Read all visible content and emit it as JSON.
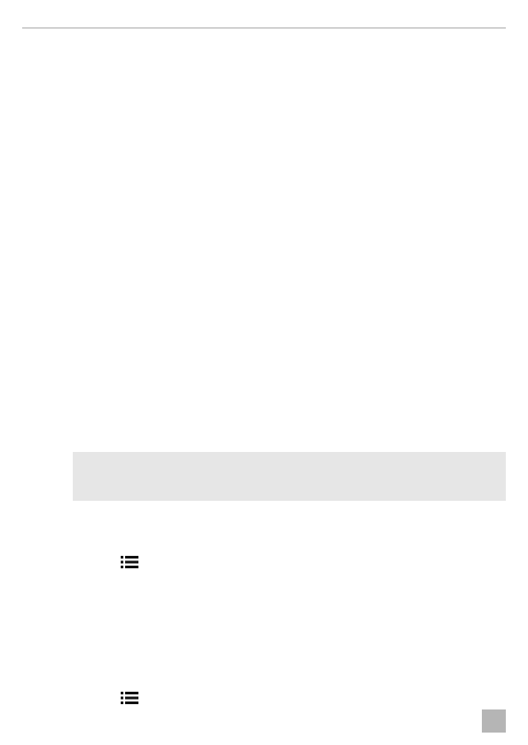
{
  "page": {
    "header": {},
    "note_box": {},
    "list_icons": [
      {
        "icon": "list-icon"
      },
      {
        "icon": "list-icon"
      }
    ],
    "page_tab": {},
    "colors": {
      "rule": "#a8a8a8",
      "note_background": "#e6e6e6",
      "icon": "#111111",
      "page_tab": "#b5b5b5"
    }
  }
}
